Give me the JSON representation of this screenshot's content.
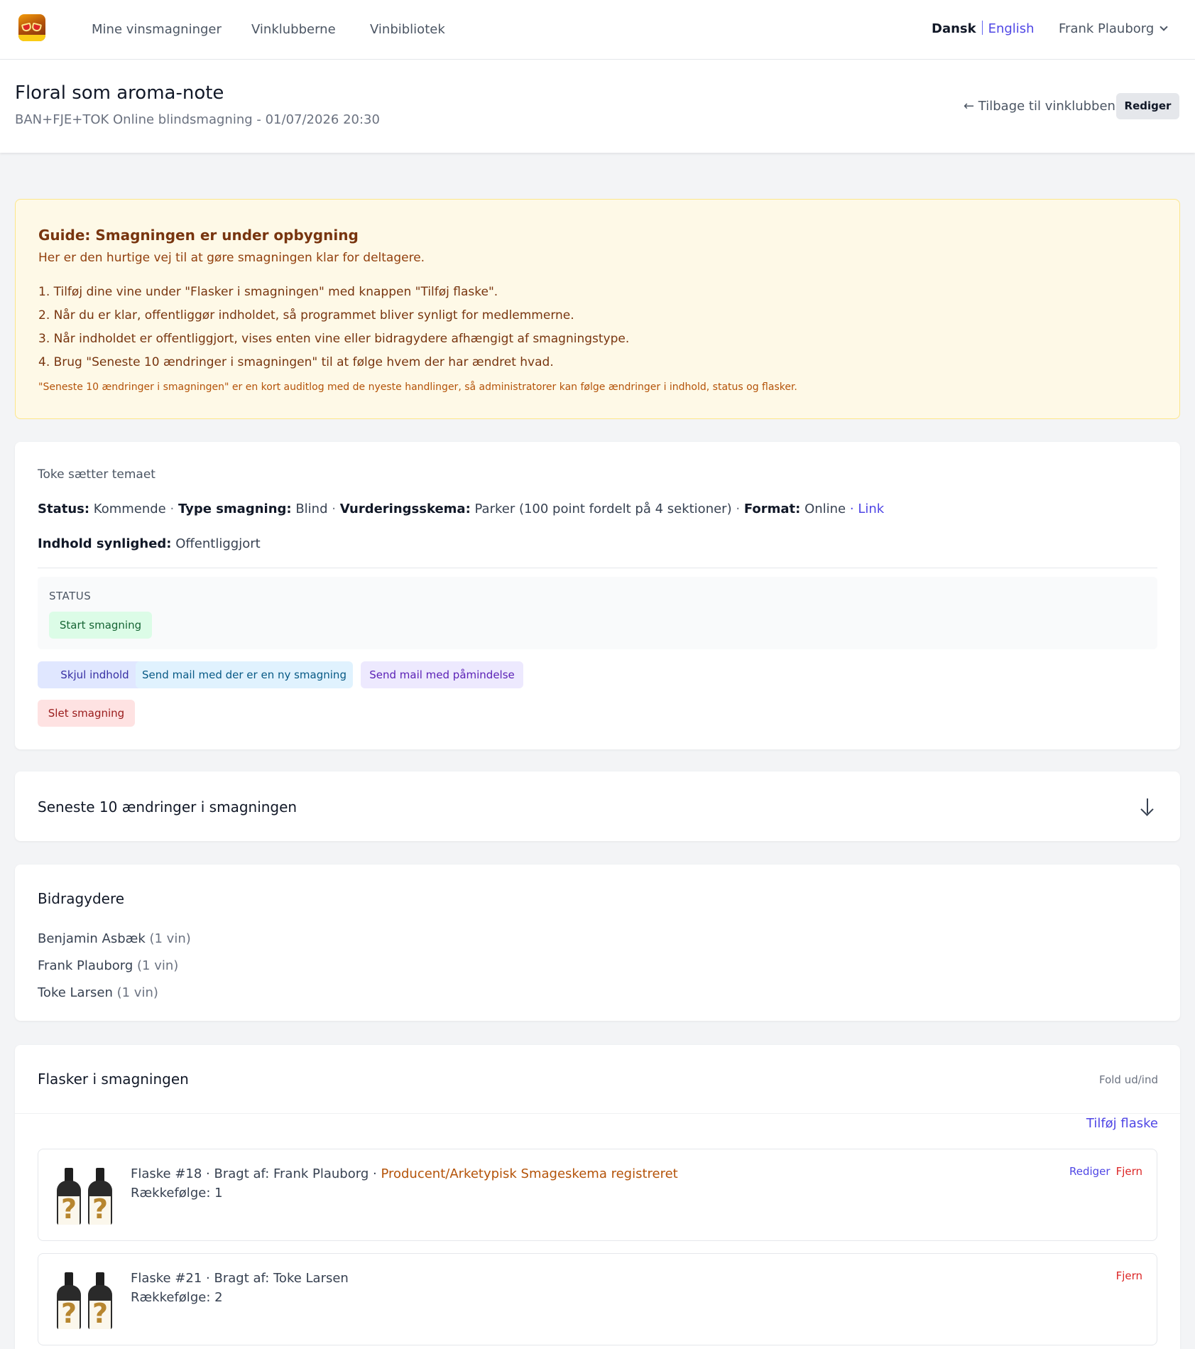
{
  "nav": {
    "links": [
      "Mine vinsmagninger",
      "Vinklubberne",
      "Vinbibliotek"
    ],
    "lang_active": "Dansk",
    "lang_other": "English",
    "user_name": "Frank Plauborg"
  },
  "header": {
    "title": "Floral som aroma-note",
    "subtitle": "BAN+FJE+TOK Online blindsmagning - 01/07/2026 20:30",
    "back_label": "← Tilbage til vinklubben",
    "edit_label": "Rediger"
  },
  "guide": {
    "title": "Guide: Smagningen er under opbygning",
    "intro": "Her er den hurtige vej til at gøre smagningen klar for deltagere.",
    "steps": [
      "1. Tilføj dine vine under \"Flasker i smagningen\" med knappen \"Tilføj flaske\".",
      "2. Når du er klar, offentliggør indholdet, så programmet bliver synligt for medlemmerne.",
      "3. Når indholdet er offentliggjort, vises enten vine eller bidragydere afhængigt af smagningstype.",
      "4. Brug \"Seneste 10 ændringer i smagningen\" til at følge hvem der har ændret hvad."
    ],
    "note": "\"Seneste 10 ændringer i smagningen\" er en kort auditlog med de nyeste handlinger, så administratorer kan følge ændringer i indhold, status og flasker."
  },
  "details": {
    "theme": "Toke sætter temaet",
    "status_key": "Status:",
    "status_val": "Kommende",
    "type_key": "Type smagning:",
    "type_val": "Blind",
    "scheme_key": "Vurderingsskema:",
    "scheme_val": "Parker (100 point fordelt på 4 sektioner)",
    "format_key": "Format:",
    "format_val": "Online",
    "link_label": "Link",
    "separator": "·",
    "visibility_key": "Indhold synlighed:",
    "visibility_val": "Offentliggjort",
    "status_section_label": "STATUS",
    "start_label": "Start smagning",
    "hide_label": "Skjul indhold",
    "newmail_label": "Send mail med der er en ny smagning",
    "remind_label": "Send mail med påmindelse",
    "delete_label": "Slet smagning"
  },
  "changes": {
    "title": "Seneste 10 ændringer i smagningen"
  },
  "contributors": {
    "title": "Bidragydere",
    "items": [
      {
        "name": "Benjamin Asbæk",
        "count": "(1 vin)"
      },
      {
        "name": "Frank Plauborg",
        "count": "(1 vin)"
      },
      {
        "name": "Toke Larsen",
        "count": "(1 vin)"
      }
    ]
  },
  "bottles": {
    "title": "Flasker i smagningen",
    "fold_label": "Fold ud/ind",
    "add_label": "Tilføj flaske",
    "items": [
      {
        "line1": "Flaske #18 · Bragt af: Frank Plauborg ·",
        "registered": "Producent/Arketypisk Smageskema registreret",
        "order": "Rækkefølge: 1",
        "edit": "Rediger",
        "remove": "Fjern"
      },
      {
        "line1": "Flaske #21 · Bragt af: Toke Larsen",
        "order": "Rækkefølge: 2",
        "remove": "Fjern"
      }
    ]
  }
}
